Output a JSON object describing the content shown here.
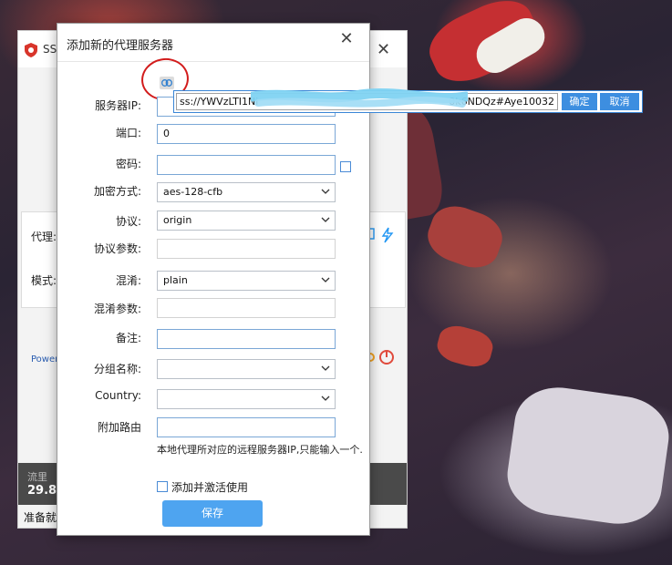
{
  "bg_window": {
    "title": "SS",
    "proxy_label": "代理:",
    "mode_label": "模式:",
    "power_text": "Power",
    "stats_label": "流里",
    "stats_value": "29.8",
    "status_text": "准备就"
  },
  "dialog": {
    "title": "添加新的代理服务器",
    "fields": {
      "server_ip": {
        "label": "服务器IP:"
      },
      "port": {
        "label": "端口:",
        "value": "0"
      },
      "password": {
        "label": "密码:",
        "value": ""
      },
      "encryption": {
        "label": "加密方式:",
        "value": "aes-128-cfb"
      },
      "protocol": {
        "label": "协议:",
        "value": "origin"
      },
      "protocol_param": {
        "label": "协议参数:",
        "value": ""
      },
      "obfs": {
        "label": "混淆:",
        "value": "plain"
      },
      "obfs_param": {
        "label": "混淆参数:",
        "value": ""
      },
      "remark": {
        "label": "备注:",
        "value": ""
      },
      "group": {
        "label": "分组名称:",
        "value": ""
      },
      "country": {
        "label": "Country:",
        "value": ""
      },
      "extra_route": {
        "label": "附加路由",
        "value": ""
      }
    },
    "hint": "本地代理所对应的远程服务器IP,只能输入一个.",
    "activate_label": "添加并激活使用",
    "save_label": "保存"
  },
  "url_editor": {
    "value_start": "ss://YWVzLTI1Ni",
    "value_end": "0k6NDQz#Aye10032",
    "confirm_label": "确定",
    "cancel_label": "取消"
  },
  "colors": {
    "accent": "#3d8ee0",
    "save_button": "#4ea4f0",
    "annotation": "#d21c1c"
  }
}
